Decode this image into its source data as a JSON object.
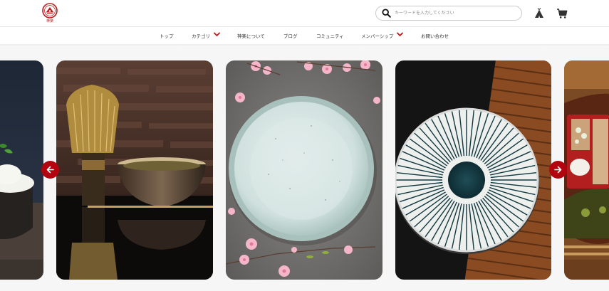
{
  "brand": {
    "logo_text": "神楽"
  },
  "search": {
    "placeholder": "キーワードを入力してください"
  },
  "header_icons": {
    "community": "tipi-tent-icon",
    "cart": "shopping-cart-icon"
  },
  "nav": {
    "items": [
      {
        "label": "トップ"
      },
      {
        "label": "カテゴリ"
      },
      {
        "label": "神楽について"
      },
      {
        "label": "ブログ"
      },
      {
        "label": "コミュニティ"
      },
      {
        "label": "メンバーシップ"
      },
      {
        "label": "お問い合わせ"
      }
    ]
  },
  "carousel": {
    "prev_icon": "arrow-left-icon",
    "next_icon": "arrow-right-icon",
    "slides": [
      {
        "subject": "rice bowl"
      },
      {
        "subject": "matcha whisk and bowl"
      },
      {
        "subject": "speckled celadon plate with cherry blossoms"
      },
      {
        "subject": "striped ceramic plate on bamboo mat"
      },
      {
        "subject": "soba and condiments"
      }
    ]
  },
  "colors": {
    "accent": "#b2050f",
    "chevron": "#b71c1c"
  }
}
